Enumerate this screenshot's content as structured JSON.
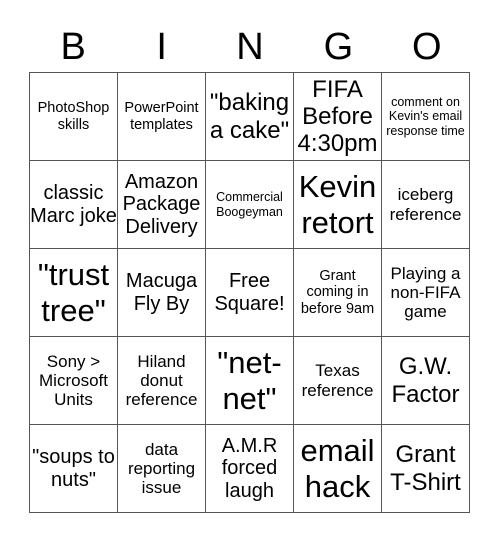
{
  "header": {
    "letters": [
      "B",
      "I",
      "N",
      "G",
      "O"
    ]
  },
  "board": {
    "rows": [
      [
        {
          "text": "PhotoShop skills",
          "size": "s"
        },
        {
          "text": "PowerPoint templates",
          "size": "s"
        },
        {
          "text": "\"baking a cake\"",
          "size": "xl"
        },
        {
          "text": "FIFA Before 4:30pm",
          "size": "xl"
        },
        {
          "text": "comment on Kevin's email response time",
          "size": "xs"
        }
      ],
      [
        {
          "text": "classic Marc joke",
          "size": "l"
        },
        {
          "text": "Amazon Package Delivery",
          "size": "l"
        },
        {
          "text": "Commercial Boogeyman",
          "size": "xs"
        },
        {
          "text": "Kevin retort",
          "size": "xxl"
        },
        {
          "text": "iceberg reference",
          "size": "m"
        }
      ],
      [
        {
          "text": "\"trust tree\"",
          "size": "xxl"
        },
        {
          "text": "Macuga Fly By",
          "size": "l"
        },
        {
          "text": "Free Square!",
          "size": "l"
        },
        {
          "text": "Grant coming in before 9am",
          "size": "s"
        },
        {
          "text": "Playing a non-FIFA game",
          "size": "m"
        }
      ],
      [
        {
          "text": "Sony > Microsoft Units",
          "size": "m"
        },
        {
          "text": "Hiland donut reference",
          "size": "m"
        },
        {
          "text": "\"net-net\"",
          "size": "xxl"
        },
        {
          "text": "Texas reference",
          "size": "m"
        },
        {
          "text": "G.W. Factor",
          "size": "xl"
        }
      ],
      [
        {
          "text": "\"soups to nuts\"",
          "size": "l"
        },
        {
          "text": "data reporting issue",
          "size": "m"
        },
        {
          "text": "A.M.R forced laugh",
          "size": "l"
        },
        {
          "text": "email hack",
          "size": "xxl"
        },
        {
          "text": "Grant T-Shirt",
          "size": "xl"
        }
      ]
    ]
  }
}
